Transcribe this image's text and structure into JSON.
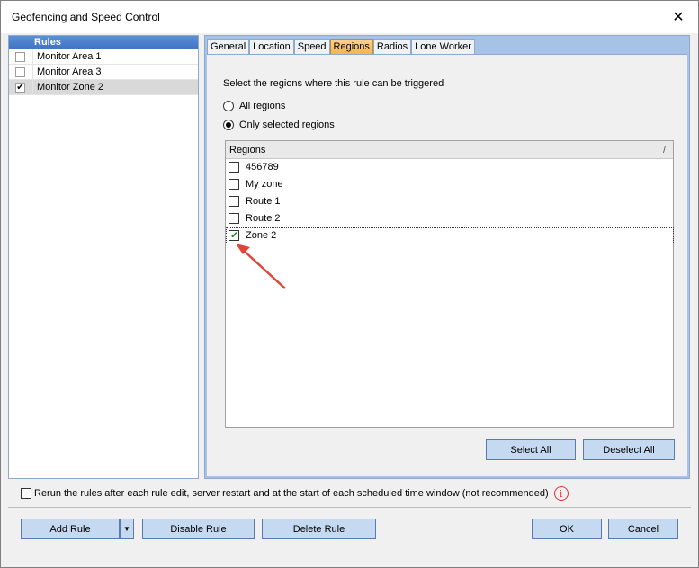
{
  "window": {
    "title": "Geofencing and Speed Control",
    "close_label": "✕"
  },
  "rules": {
    "header": "Rules",
    "items": [
      {
        "label": "Monitor Area 1",
        "checked": false
      },
      {
        "label": "Monitor Area 3",
        "checked": false
      },
      {
        "label": "Monitor Zone 2",
        "checked": true
      }
    ]
  },
  "tabs": [
    {
      "label": "General",
      "active": false
    },
    {
      "label": "Location",
      "active": false
    },
    {
      "label": "Speed",
      "active": false
    },
    {
      "label": "Regions",
      "active": true
    },
    {
      "label": "Radios",
      "active": false
    },
    {
      "label": "Lone Worker",
      "active": false
    }
  ],
  "regions_tab": {
    "instruction": "Select the regions where this rule can be triggered",
    "radio_all": "All regions",
    "radio_selected": "Only selected regions",
    "list_header": "Regions",
    "sort_glyph": "/",
    "items": [
      {
        "label": "456789",
        "checked": false
      },
      {
        "label": "My zone",
        "checked": false
      },
      {
        "label": "Route 1",
        "checked": false
      },
      {
        "label": "Route 2",
        "checked": false
      },
      {
        "label": "Zone 2",
        "checked": true
      }
    ],
    "select_all": "Select All",
    "deselect_all": "Deselect All"
  },
  "rerun_text": "Rerun the rules after each rule edit, server restart and at the start of each scheduled time window (not recommended)",
  "info_glyph": "i",
  "footer": {
    "add_rule": "Add Rule",
    "disable_rule": "Disable Rule",
    "delete_rule": "Delete Rule",
    "ok": "OK",
    "cancel": "Cancel"
  },
  "colors": {
    "accent_arrow": "#e0453a",
    "tab_active": "#f6b44b",
    "button": "#c5d9f1"
  }
}
